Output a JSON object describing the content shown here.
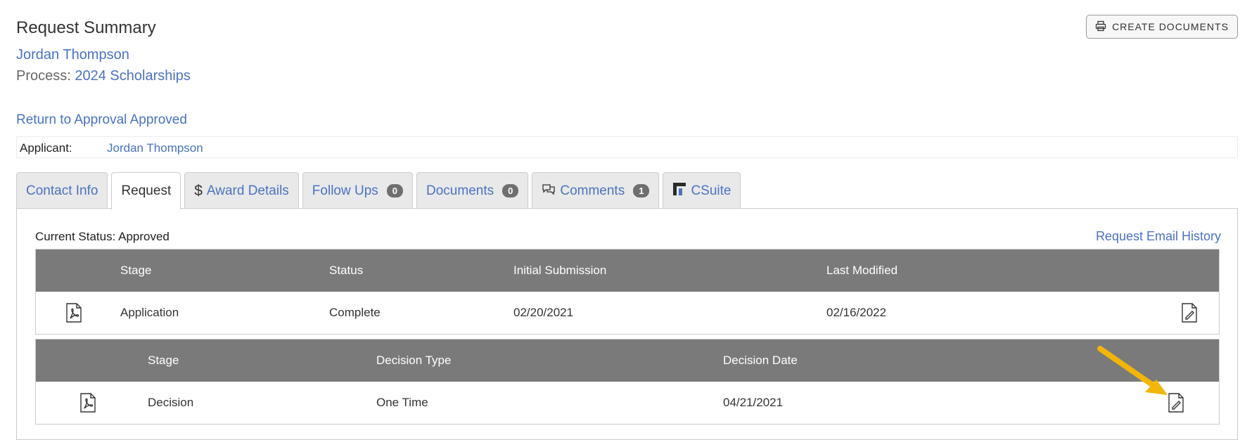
{
  "header": {
    "title": "Request Summary",
    "student_name": "Jordan Thompson",
    "process_label": "Process:",
    "process_name": "2024 Scholarships",
    "return_link": "Return to Approval Approved",
    "create_documents": "CREATE DOCUMENTS"
  },
  "applicant": {
    "label": "Applicant:",
    "name": "Jordan Thompson"
  },
  "tabs": [
    {
      "label": "Contact Info"
    },
    {
      "label": "Request"
    },
    {
      "label": "Award Details"
    },
    {
      "label": "Follow Ups",
      "badge": "0"
    },
    {
      "label": "Documents",
      "badge": "0"
    },
    {
      "label": "Comments",
      "badge": "1"
    },
    {
      "label": "CSuite"
    }
  ],
  "request": {
    "current_status": "Current Status: Approved",
    "email_history": "Request Email History",
    "stages_table": {
      "headers": [
        "Stage",
        "Status",
        "Initial Submission",
        "Last Modified"
      ],
      "row": [
        "Application",
        "Complete",
        "02/20/2021",
        "02/16/2022"
      ]
    },
    "decision_table": {
      "headers": [
        "Stage",
        "Decision Type",
        "Decision Date"
      ],
      "row": [
        "Decision",
        "One Time",
        "04/21/2021"
      ]
    }
  },
  "colors": {
    "link": "#4a72c4",
    "table_header": "#7a7a7a",
    "arrow": "#f2b705"
  }
}
